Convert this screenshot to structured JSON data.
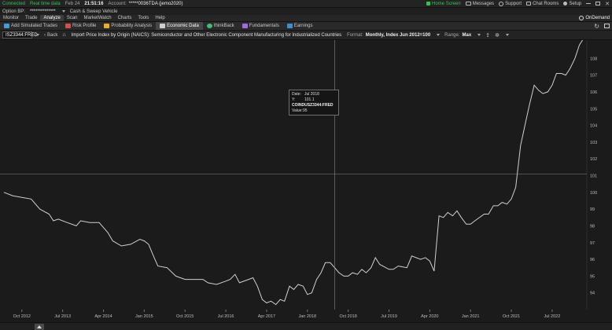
{
  "status": {
    "connected": "Connected",
    "realtime": "Real time data",
    "date": "Feb 24",
    "time": "21:51:16",
    "account_label": "Account:",
    "account_value": "*****0036TDA (jemo2020)",
    "home": "Home Screen",
    "messages": "Messages",
    "support": "Support",
    "chat": "Chat Rooms",
    "setup": "Setup"
  },
  "account_bar": {
    "option_bp_label": "Option BP:",
    "option_bp_value": "**************",
    "cash_sweep": "Cash & Sweep Vehicle"
  },
  "nav": {
    "tabs": [
      "Monitor",
      "Trade",
      "Analyze",
      "Scan",
      "MarketWatch",
      "Charts",
      "Tools",
      "Help"
    ],
    "active": "Analyze",
    "ondemand": "OnDemand"
  },
  "tools": {
    "items": [
      "Add Simulated Trades",
      "Risk Profile",
      "Probability Analysis",
      "Economic Data",
      "thinkBack",
      "Fundamentals",
      "Earnings"
    ],
    "active": "Economic Data",
    "icon_colors": [
      "#3ba0d8",
      "#d84c4c",
      "#e0b030",
      "#cfcfcf",
      "#3bbf7a",
      "#9a6fd8",
      "#3b8fd8"
    ]
  },
  "command": {
    "symbol": "ISZ3344:FRED",
    "back": "Back",
    "title": "Import Price Index by Origin (NAICS): Semiconductor and Other Electronic Component Manufacturing for Industrialized Countries",
    "format_label": "Format:",
    "format_value": "Monthly, Index Jun 2012=100",
    "range_label": "Range:",
    "range_value": "Max"
  },
  "tooltip": {
    "date_label": "Date:",
    "date_value": "Jul 2018",
    "y_label": "Y:",
    "y_value": "101.1",
    "series": "COINDUSZ3344:FRED",
    "value_label": "Value:",
    "value_value": "95"
  },
  "chart_data": {
    "type": "line",
    "series_color": "#d0d0d0",
    "ylim": [
      93,
      109
    ],
    "yticks": [
      94,
      95,
      96,
      97,
      98,
      99,
      100,
      101,
      102,
      103,
      104,
      105,
      106,
      107,
      108
    ],
    "xticks": [
      "Oct 2012",
      "Jul 2013",
      "Apr 2014",
      "Jan 2015",
      "Oct 2015",
      "Jul 2016",
      "Apr 2017",
      "Jan 2018",
      "Oct 2018",
      "Jul 2019",
      "Apr 2020",
      "Jan 2021",
      "Oct 2021",
      "Jul 2022"
    ],
    "crosshair": {
      "date": "Jul 2018",
      "y": 101.1
    },
    "points": [
      [
        2012.42,
        100.0
      ],
      [
        2012.58,
        99.8
      ],
      [
        2012.75,
        99.7
      ],
      [
        2012.92,
        99.6
      ],
      [
        2013.08,
        99.0
      ],
      [
        2013.25,
        98.7
      ],
      [
        2013.33,
        98.3
      ],
      [
        2013.42,
        98.4
      ],
      [
        2013.58,
        98.2
      ],
      [
        2013.75,
        98.0
      ],
      [
        2013.83,
        98.3
      ],
      [
        2014.0,
        98.2
      ],
      [
        2014.17,
        98.2
      ],
      [
        2014.33,
        97.6
      ],
      [
        2014.42,
        97.1
      ],
      [
        2014.58,
        96.8
      ],
      [
        2014.75,
        96.9
      ],
      [
        2014.92,
        97.2
      ],
      [
        2015.0,
        97.1
      ],
      [
        2015.08,
        96.9
      ],
      [
        2015.17,
        96.2
      ],
      [
        2015.25,
        95.6
      ],
      [
        2015.42,
        95.5
      ],
      [
        2015.58,
        95.0
      ],
      [
        2015.75,
        94.8
      ],
      [
        2015.92,
        94.8
      ],
      [
        2016.08,
        94.8
      ],
      [
        2016.17,
        94.6
      ],
      [
        2016.33,
        94.5
      ],
      [
        2016.5,
        94.7
      ],
      [
        2016.58,
        94.8
      ],
      [
        2016.67,
        95.1
      ],
      [
        2016.75,
        94.6
      ],
      [
        2016.92,
        94.8
      ],
      [
        2017.0,
        94.9
      ],
      [
        2017.08,
        94.4
      ],
      [
        2017.17,
        93.6
      ],
      [
        2017.25,
        93.4
      ],
      [
        2017.33,
        93.5
      ],
      [
        2017.42,
        93.3
      ],
      [
        2017.5,
        93.6
      ],
      [
        2017.58,
        93.5
      ],
      [
        2017.67,
        94.4
      ],
      [
        2017.75,
        94.2
      ],
      [
        2017.83,
        94.5
      ],
      [
        2017.92,
        94.4
      ],
      [
        2018.0,
        93.9
      ],
      [
        2018.08,
        94.0
      ],
      [
        2018.17,
        94.8
      ],
      [
        2018.25,
        95.2
      ],
      [
        2018.33,
        95.8
      ],
      [
        2018.42,
        95.8
      ],
      [
        2018.5,
        95.5
      ],
      [
        2018.58,
        95.2
      ],
      [
        2018.67,
        95.0
      ],
      [
        2018.75,
        95.0
      ],
      [
        2018.83,
        95.2
      ],
      [
        2018.92,
        95.1
      ],
      [
        2019.0,
        95.4
      ],
      [
        2019.08,
        95.2
      ],
      [
        2019.17,
        95.5
      ],
      [
        2019.25,
        96.1
      ],
      [
        2019.33,
        95.7
      ],
      [
        2019.5,
        95.4
      ],
      [
        2019.58,
        95.4
      ],
      [
        2019.67,
        95.6
      ],
      [
        2019.83,
        95.5
      ],
      [
        2019.92,
        96.2
      ],
      [
        2020.08,
        96.0
      ],
      [
        2020.17,
        96.1
      ],
      [
        2020.25,
        95.9
      ],
      [
        2020.33,
        95.3
      ],
      [
        2020.42,
        98.6
      ],
      [
        2020.5,
        98.5
      ],
      [
        2020.58,
        98.8
      ],
      [
        2020.67,
        98.6
      ],
      [
        2020.75,
        98.9
      ],
      [
        2020.83,
        98.5
      ],
      [
        2020.92,
        98.1
      ],
      [
        2021.0,
        98.1
      ],
      [
        2021.08,
        98.3
      ],
      [
        2021.25,
        98.7
      ],
      [
        2021.33,
        98.7
      ],
      [
        2021.42,
        99.2
      ],
      [
        2021.5,
        99.2
      ],
      [
        2021.58,
        99.4
      ],
      [
        2021.67,
        99.3
      ],
      [
        2021.75,
        99.6
      ],
      [
        2021.83,
        100.3
      ],
      [
        2021.92,
        102.8
      ],
      [
        2022.0,
        104.0
      ],
      [
        2022.08,
        105.2
      ],
      [
        2022.17,
        106.4
      ],
      [
        2022.25,
        106.1
      ],
      [
        2022.33,
        105.9
      ],
      [
        2022.42,
        106.0
      ],
      [
        2022.5,
        106.4
      ],
      [
        2022.58,
        107.1
      ],
      [
        2022.67,
        107.1
      ],
      [
        2022.75,
        107.0
      ],
      [
        2022.83,
        107.4
      ],
      [
        2022.92,
        108.0
      ],
      [
        2023.0,
        108.8
      ],
      [
        2023.08,
        109.2
      ]
    ]
  }
}
